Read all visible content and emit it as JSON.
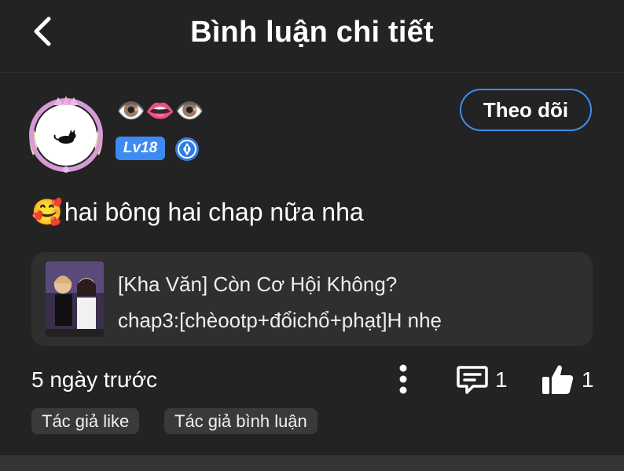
{
  "header": {
    "title": "Bình luận chi tiết",
    "back_icon": "chevron-left-icon"
  },
  "user": {
    "name": "👁️👄👁️",
    "level": "Lv18",
    "verify_icon": "pen-badge-icon",
    "avatar_icon": "black-cat-icon"
  },
  "follow_button": {
    "label": "Theo dõi",
    "color": "#3b8ff0"
  },
  "comment": {
    "emoji": "🥰",
    "text": "hai bông hai chap nữa nha"
  },
  "story": {
    "title": "[Kha Văn] Còn Cơ Hội Không?",
    "chapter": "chap3:[chèootp+đổichổ+phạt]H nhẹ"
  },
  "meta": {
    "time": "5 ngày trước",
    "reply_count": "1",
    "like_count": "1"
  },
  "tags": [
    "Tác giả like",
    "Tác giả bình luận"
  ],
  "colors": {
    "background": "#232323",
    "accent": "#3b8ff0",
    "card": "#2f2f2f"
  }
}
